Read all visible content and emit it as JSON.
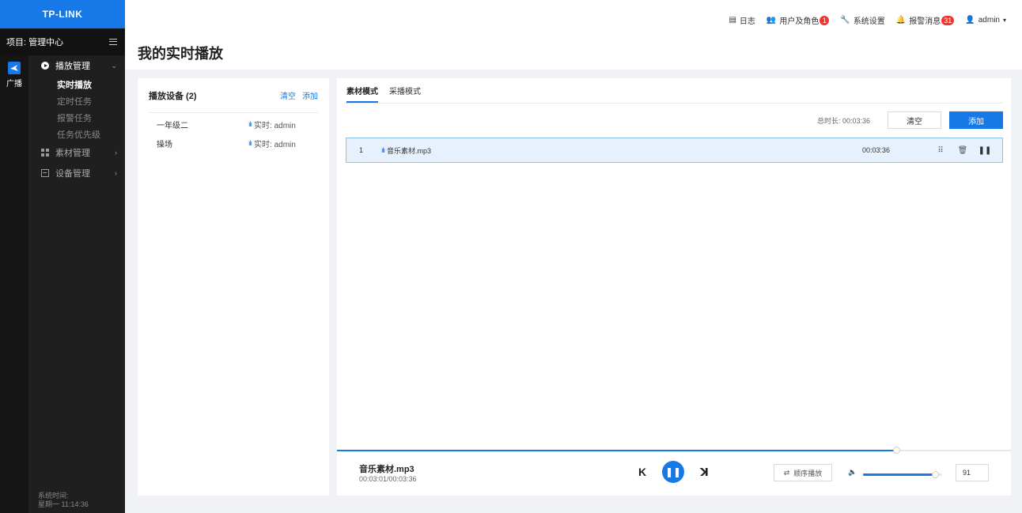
{
  "sidebar": {
    "logo": "TP-LINK",
    "project_label": "项目: 管理中心",
    "rail": [
      {
        "label": "广播",
        "icon": "broadcast-icon"
      }
    ],
    "nav": {
      "broadcast_group": "播放管理",
      "sub_items": [
        "实时播放",
        "定时任务",
        "报警任务",
        "任务优先级"
      ],
      "active_sub": "实时播放",
      "material_group": "素材管理",
      "device_group": "设备管理"
    },
    "system_time_label": "系统时间:",
    "system_time_value": "星期一 11:14:36"
  },
  "topbar": {
    "log": "日志",
    "users": "用户及角色",
    "users_badge": "1",
    "settings": "系统设置",
    "alarms": "报警消息",
    "alarms_badge": "31",
    "user": "admin"
  },
  "page_title": "我的实时播放",
  "device_panel": {
    "title": "播放设备 (2)",
    "clear": "清空",
    "add": "添加",
    "devices": [
      {
        "name": "一年级二",
        "status": "实时: admin"
      },
      {
        "name": "操场",
        "status": "实时: admin"
      }
    ]
  },
  "playlist": {
    "tabs": [
      "素材模式",
      "采播模式"
    ],
    "active_tab": 0,
    "total_label": "总时长: 00:03:36",
    "clear_btn": "清空",
    "add_btn": "添加",
    "tracks": [
      {
        "index": "1",
        "name": "音乐素材.mp3",
        "duration": "00:03:36"
      }
    ]
  },
  "player": {
    "title": "音乐素材.mp3",
    "time": "00:03:01/00:03:36",
    "progress": 0.83,
    "mode": "顺序播放",
    "volume": "91",
    "volume_level": 0.91
  },
  "colors": {
    "accent": "#1779e8",
    "sidebar": "#1f1f1f",
    "badge": "#f5342f"
  }
}
